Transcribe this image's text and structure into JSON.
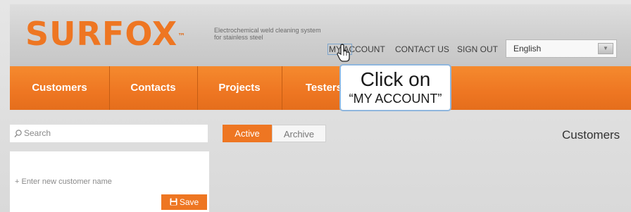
{
  "brand": {
    "logo": "SURFOX",
    "trademark": "™",
    "tagline_line1": "Electrochemical weld cleaning system",
    "tagline_line2": "for stainless steel",
    "accent_color": "#ee7622"
  },
  "topnav": {
    "my_account": "MY ACCOUNT",
    "contact_us": "CONTACT US",
    "sign_out": "SIGN OUT",
    "language_selected": "English",
    "language_dropdown_icon": "chevron-down-icon"
  },
  "menu": [
    {
      "label": "Customers"
    },
    {
      "label": "Contacts"
    },
    {
      "label": "Projects"
    },
    {
      "label": "Testers"
    }
  ],
  "tooltip": {
    "line1": "Click on",
    "line2": "“MY ACCOUNT”"
  },
  "search": {
    "placeholder": "Search",
    "icon": "search-icon"
  },
  "tabs": {
    "active": "Active",
    "archive": "Archive"
  },
  "page_title": "Customers",
  "new_customer": {
    "placeholder": "+ Enter new customer name",
    "save_label": "Save",
    "save_icon": "save-icon"
  }
}
